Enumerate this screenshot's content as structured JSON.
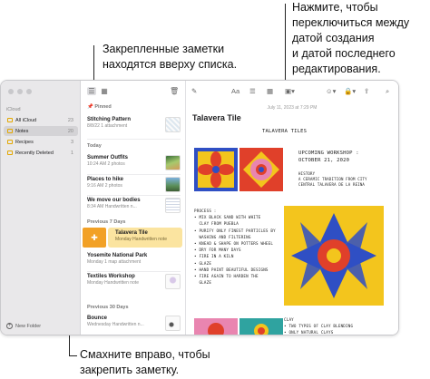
{
  "callouts": {
    "top_right": [
      "Нажмите, чтобы",
      "переключиться между",
      "датой создания",
      "и датой последнего",
      "редактирования."
    ],
    "top_left": [
      "Закрепленные заметки",
      "находятся вверху списка."
    ],
    "bottom": [
      "Смахните вправо, чтобы",
      "закрепить заметку."
    ]
  },
  "sidebar": {
    "account": "iCloud",
    "folders": [
      {
        "label": "All iCloud",
        "count": "23",
        "active": false
      },
      {
        "label": "Notes",
        "count": "20",
        "active": true
      },
      {
        "label": "Recipes",
        "count": "3",
        "active": false
      },
      {
        "label": "Recently Deleted",
        "count": "1",
        "active": false
      }
    ],
    "new_folder": "New Folder"
  },
  "list": {
    "pinned_header": "Pinned",
    "today_header": "Today",
    "prev7_header": "Previous 7 Days",
    "prev30_header": "Previous 30 Days",
    "notes": {
      "stitching": {
        "title": "Stitching Pattern",
        "sub": "8/8/22   1 attachment"
      },
      "summer": {
        "title": "Summer Outfits",
        "sub": "10:24 AM   2 photos"
      },
      "places": {
        "title": "Places to hike",
        "sub": "9:16 AM   2 photos"
      },
      "move": {
        "title": "We move our bodies",
        "sub": "8:34 AM   Handwritten n..."
      },
      "talavera": {
        "title": "Talavera Tile",
        "sub": "Monday   Handwritten note"
      },
      "yosemite": {
        "title": "Yosemite National Park",
        "sub": "Monday   1 map attachment"
      },
      "textiles": {
        "title": "Textiles Workshop",
        "sub": "Monday   Handwritten note"
      },
      "bounce": {
        "title": "Bounce",
        "sub": "Wednesday   Handwritten n..."
      }
    }
  },
  "editor": {
    "date": "July 11, 2023 at 7:29 PM",
    "title": "Talavera Tile",
    "hand_title": "TALAVERA TILES",
    "hand_workshop": "UPCOMING WORKSHOP :\nOCTOBER 21, 2020",
    "hand_history": "HISTORY\nA CERAMIC TRADITION FROM CITY\nCENTRAL TALAVERA DE LA REINA",
    "hand_process": "PROCESS :\n• MIX BLACK SAND WITH WHITE\n  CLAY FROM PUEBLA\n• PURIFY ONLY FINEST PARTICLES BY\n  WASHING AND FILTERING\n• KNEAD & SHAPE ON POTTERS WHEEL\n• DRY FOR MANY DAYS\n• FIRE IN A KILN\n• GLAZE\n• HAND PAINT BEAUTIFUL DESIGNS\n• FIRE AGAIN TO HARDEN THE\n  GLAZE",
    "hand_clay": "CLAY\n• TWO TYPES OF CLAY BLENDING\n• ONLY NATURAL CLAYS"
  },
  "colors": {
    "accent": "#f2a126",
    "tile_red": "#e0402a",
    "tile_blue": "#2f4fc4",
    "tile_yellow": "#f3c51d",
    "tile_pink": "#e985b0"
  }
}
